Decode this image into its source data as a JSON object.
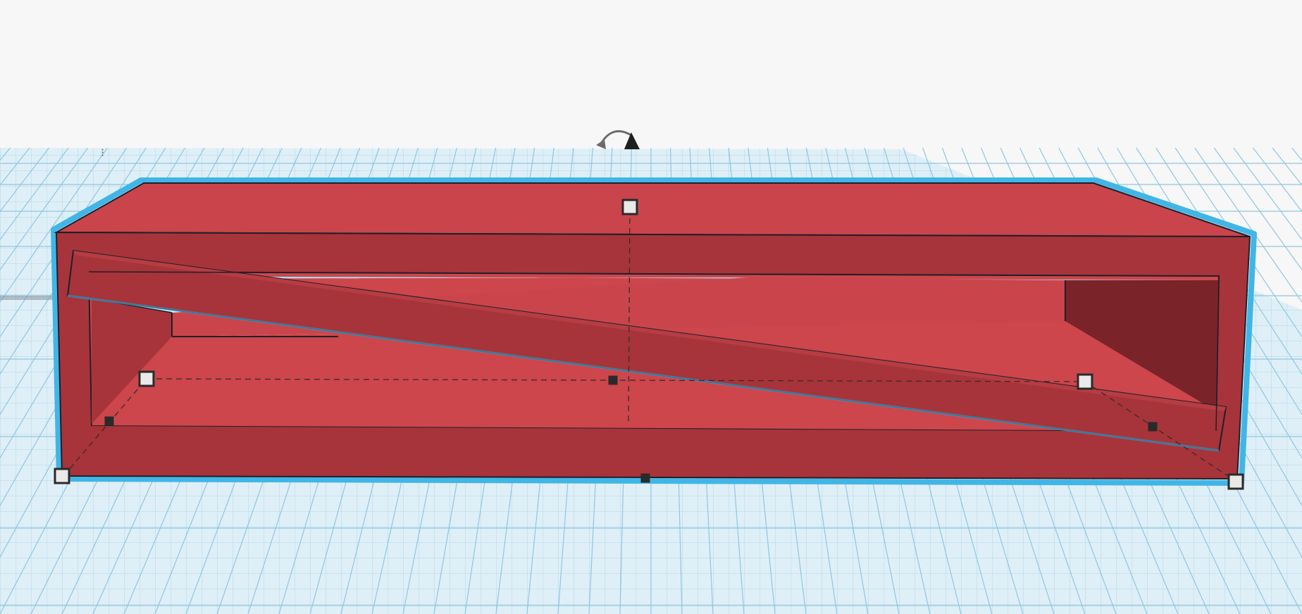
{
  "scene": {
    "background_color": "#f7f7f7",
    "workplane_color": "#dfeff7",
    "grid_line_color": "#a9d3e8",
    "grid_major_color": "#7cbfdd",
    "selection_outline_color": "#41b6e6"
  },
  "object": {
    "shape": "hollow box with diagonal bar",
    "color_front": "#a7343a",
    "color_top": "#c9454b",
    "color_floor": "#cc464c",
    "color_dark": "#7a2429",
    "edge_color": "#1f1f2a"
  },
  "gizmo": {
    "rotate_icon": "rotate-arrow-icon",
    "lift_icon": "lift-cone-icon",
    "handle_color": "#e9e9e9",
    "handle_border": "#2a2a2a"
  }
}
